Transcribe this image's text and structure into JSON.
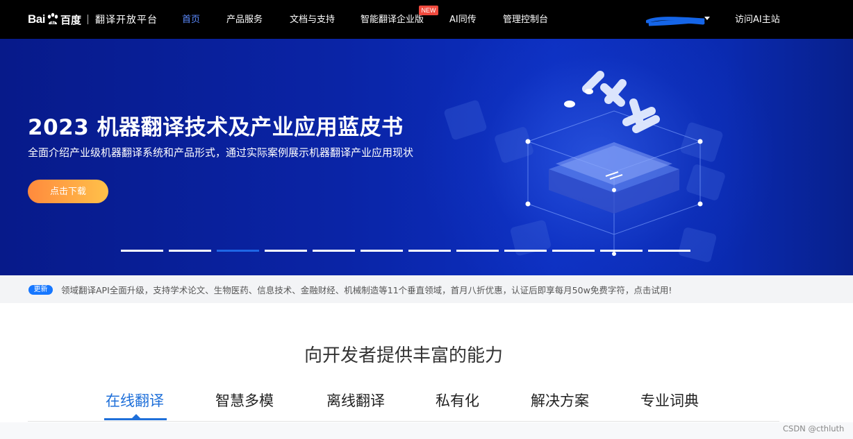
{
  "header": {
    "logo": {
      "brand_left": "Bai",
      "brand_right": "百度",
      "platform": "翻译开放平台",
      "paw_color": "#ffffff"
    },
    "nav": [
      {
        "label": "首页",
        "active": true
      },
      {
        "label": "产品服务",
        "active": false
      },
      {
        "label": "文档与支持",
        "active": false
      },
      {
        "label": "智能翻译企业版",
        "active": false,
        "badge": "NEW"
      },
      {
        "label": "AI同传",
        "active": false
      },
      {
        "label": "管理控制台",
        "active": false
      }
    ],
    "user": {
      "caret_icon": "caret-down-icon"
    },
    "visit_main": "访问AI主站"
  },
  "hero": {
    "title": "2023 机器翻译技术及产业应用蓝皮书",
    "subtitle": "全面介绍产业级机器翻译系统和产品形式，通过实际案例展示机器翻译产业应用现状",
    "button": "点击下载",
    "slides_total": 12,
    "active_slide": 3,
    "accent_color": "#1e66e6"
  },
  "notice": {
    "badge": "更新",
    "text": "领域翻译API全面升级，支持学术论文、生物医药、信息技术、金融财经、机械制造等11个垂直领域，首月八折优惠，认证后即享每月50w免费字符，点击试用!"
  },
  "capabilities": {
    "title": "向开发者提供丰富的能力",
    "tabs": [
      {
        "label": "在线翻译",
        "active": true
      },
      {
        "label": "智慧多模",
        "active": false
      },
      {
        "label": "离线翻译",
        "active": false
      },
      {
        "label": "私有化",
        "active": false
      },
      {
        "label": "解决方案",
        "active": false
      },
      {
        "label": "专业词典",
        "active": false
      }
    ],
    "active_color": "#1e6fd9"
  },
  "watermark": "CSDN @cthluth"
}
